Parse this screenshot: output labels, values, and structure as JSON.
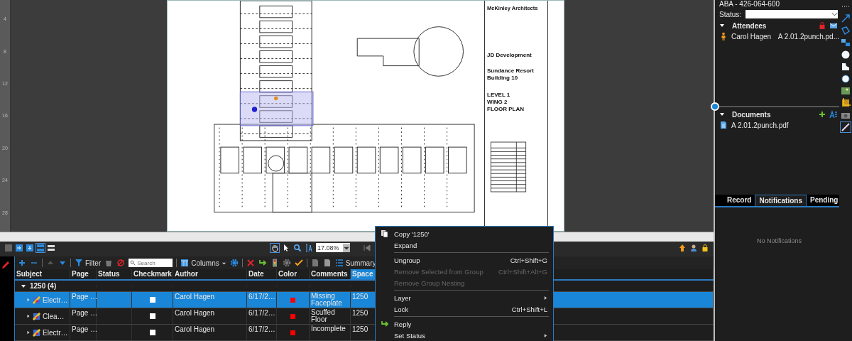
{
  "ruler": {
    "labels": [
      "4",
      "8",
      "12",
      "16",
      "20",
      "24",
      "28"
    ]
  },
  "sheet": {
    "firm": "McKinley Architects",
    "client": "JD Development",
    "project": [
      "Sundance Resort",
      "Building 10"
    ],
    "sheet_title": [
      "LEVEL 1",
      "WING 2",
      "FLOOR PLAN"
    ]
  },
  "view_toolbar": {
    "zoom": "17.08%"
  },
  "markups_toolbar": {
    "filter": "Filter",
    "search_placeholder": "Search",
    "columns": "Columns",
    "summary": "Summary"
  },
  "table": {
    "columns": [
      {
        "label": "Subject",
        "selected": false
      },
      {
        "label": "Page",
        "selected": false
      },
      {
        "label": "Status",
        "selected": false
      },
      {
        "label": "Checkmark",
        "selected": false
      },
      {
        "label": "Author",
        "selected": false
      },
      {
        "label": "Date",
        "selected": false
      },
      {
        "label": "Color",
        "selected": false
      },
      {
        "label": "Comments",
        "selected": false
      },
      {
        "label": "Space",
        "selected": true
      }
    ],
    "groups": [
      {
        "label": "1250 (4)",
        "expanded": true,
        "rows": [
          {
            "subject": "Electr…",
            "page": "Page …",
            "checked": false,
            "author": "Carol Hagen",
            "date": "6/17/2…",
            "color": "#ff0000",
            "comments": "Missing Faceplate",
            "space": "1250",
            "selected": true,
            "expanded": false
          },
          {
            "subject": "Clea…",
            "page": "Page …",
            "checked": false,
            "author": "Carol Hagen",
            "date": "6/17/2…",
            "color": "#ff0000",
            "comments": "Scuffed Floor",
            "space": "1250",
            "selected": false,
            "expanded": false
          },
          {
            "subject": "Electr…",
            "page": "Page …",
            "checked": false,
            "author": "Carol Hagen",
            "date": "6/17/2…",
            "color": "#ff0000",
            "comments": "Incomplete",
            "space": "1250",
            "selected": false,
            "expanded": false
          }
        ]
      }
    ]
  },
  "context_menu": {
    "items": [
      {
        "kind": "item",
        "label": "Copy '1250'",
        "disabled": false,
        "submenu": false
      },
      {
        "kind": "item",
        "label": "Expand",
        "disabled": false,
        "submenu": false
      },
      {
        "kind": "separator"
      },
      {
        "kind": "item",
        "label": "Ungroup",
        "shortcut": "Ctrl+Shift+G",
        "disabled": false,
        "submenu": false
      },
      {
        "kind": "item",
        "label": "Remove Selected from Group",
        "shortcut": "Ctrl+Shift+Alt+G",
        "disabled": true,
        "submenu": false
      },
      {
        "kind": "item",
        "label": "Remove Group Nesting",
        "disabled": true,
        "submenu": false
      },
      {
        "kind": "separator"
      },
      {
        "kind": "item",
        "label": "Layer",
        "disabled": false,
        "submenu": true
      },
      {
        "kind": "item",
        "label": "Lock",
        "shortcut": "Ctrl+Shift+L",
        "disabled": false,
        "submenu": false
      },
      {
        "kind": "separator"
      },
      {
        "kind": "item",
        "label": "Reply",
        "disabled": false,
        "submenu": false
      },
      {
        "kind": "item",
        "label": "Set Status",
        "disabled": false,
        "submenu": true
      }
    ]
  },
  "session": {
    "id": "ABA - 426-064-600",
    "status_label": "Status:",
    "attendees": {
      "title": "Attendees",
      "expanded": true,
      "items": [
        {
          "name": "Carol Hagen",
          "document": "A 2.01.2punch.pd..."
        }
      ]
    },
    "documents": {
      "title": "Documents",
      "expanded": true,
      "items": [
        "A 2.01.2punch.pdf"
      ]
    },
    "tabs": [
      {
        "label": "Record",
        "selected": false
      },
      {
        "label": "Notifications",
        "selected": true
      },
      {
        "label": "Pending",
        "selected": false
      }
    ],
    "empty": "No Notifications"
  }
}
